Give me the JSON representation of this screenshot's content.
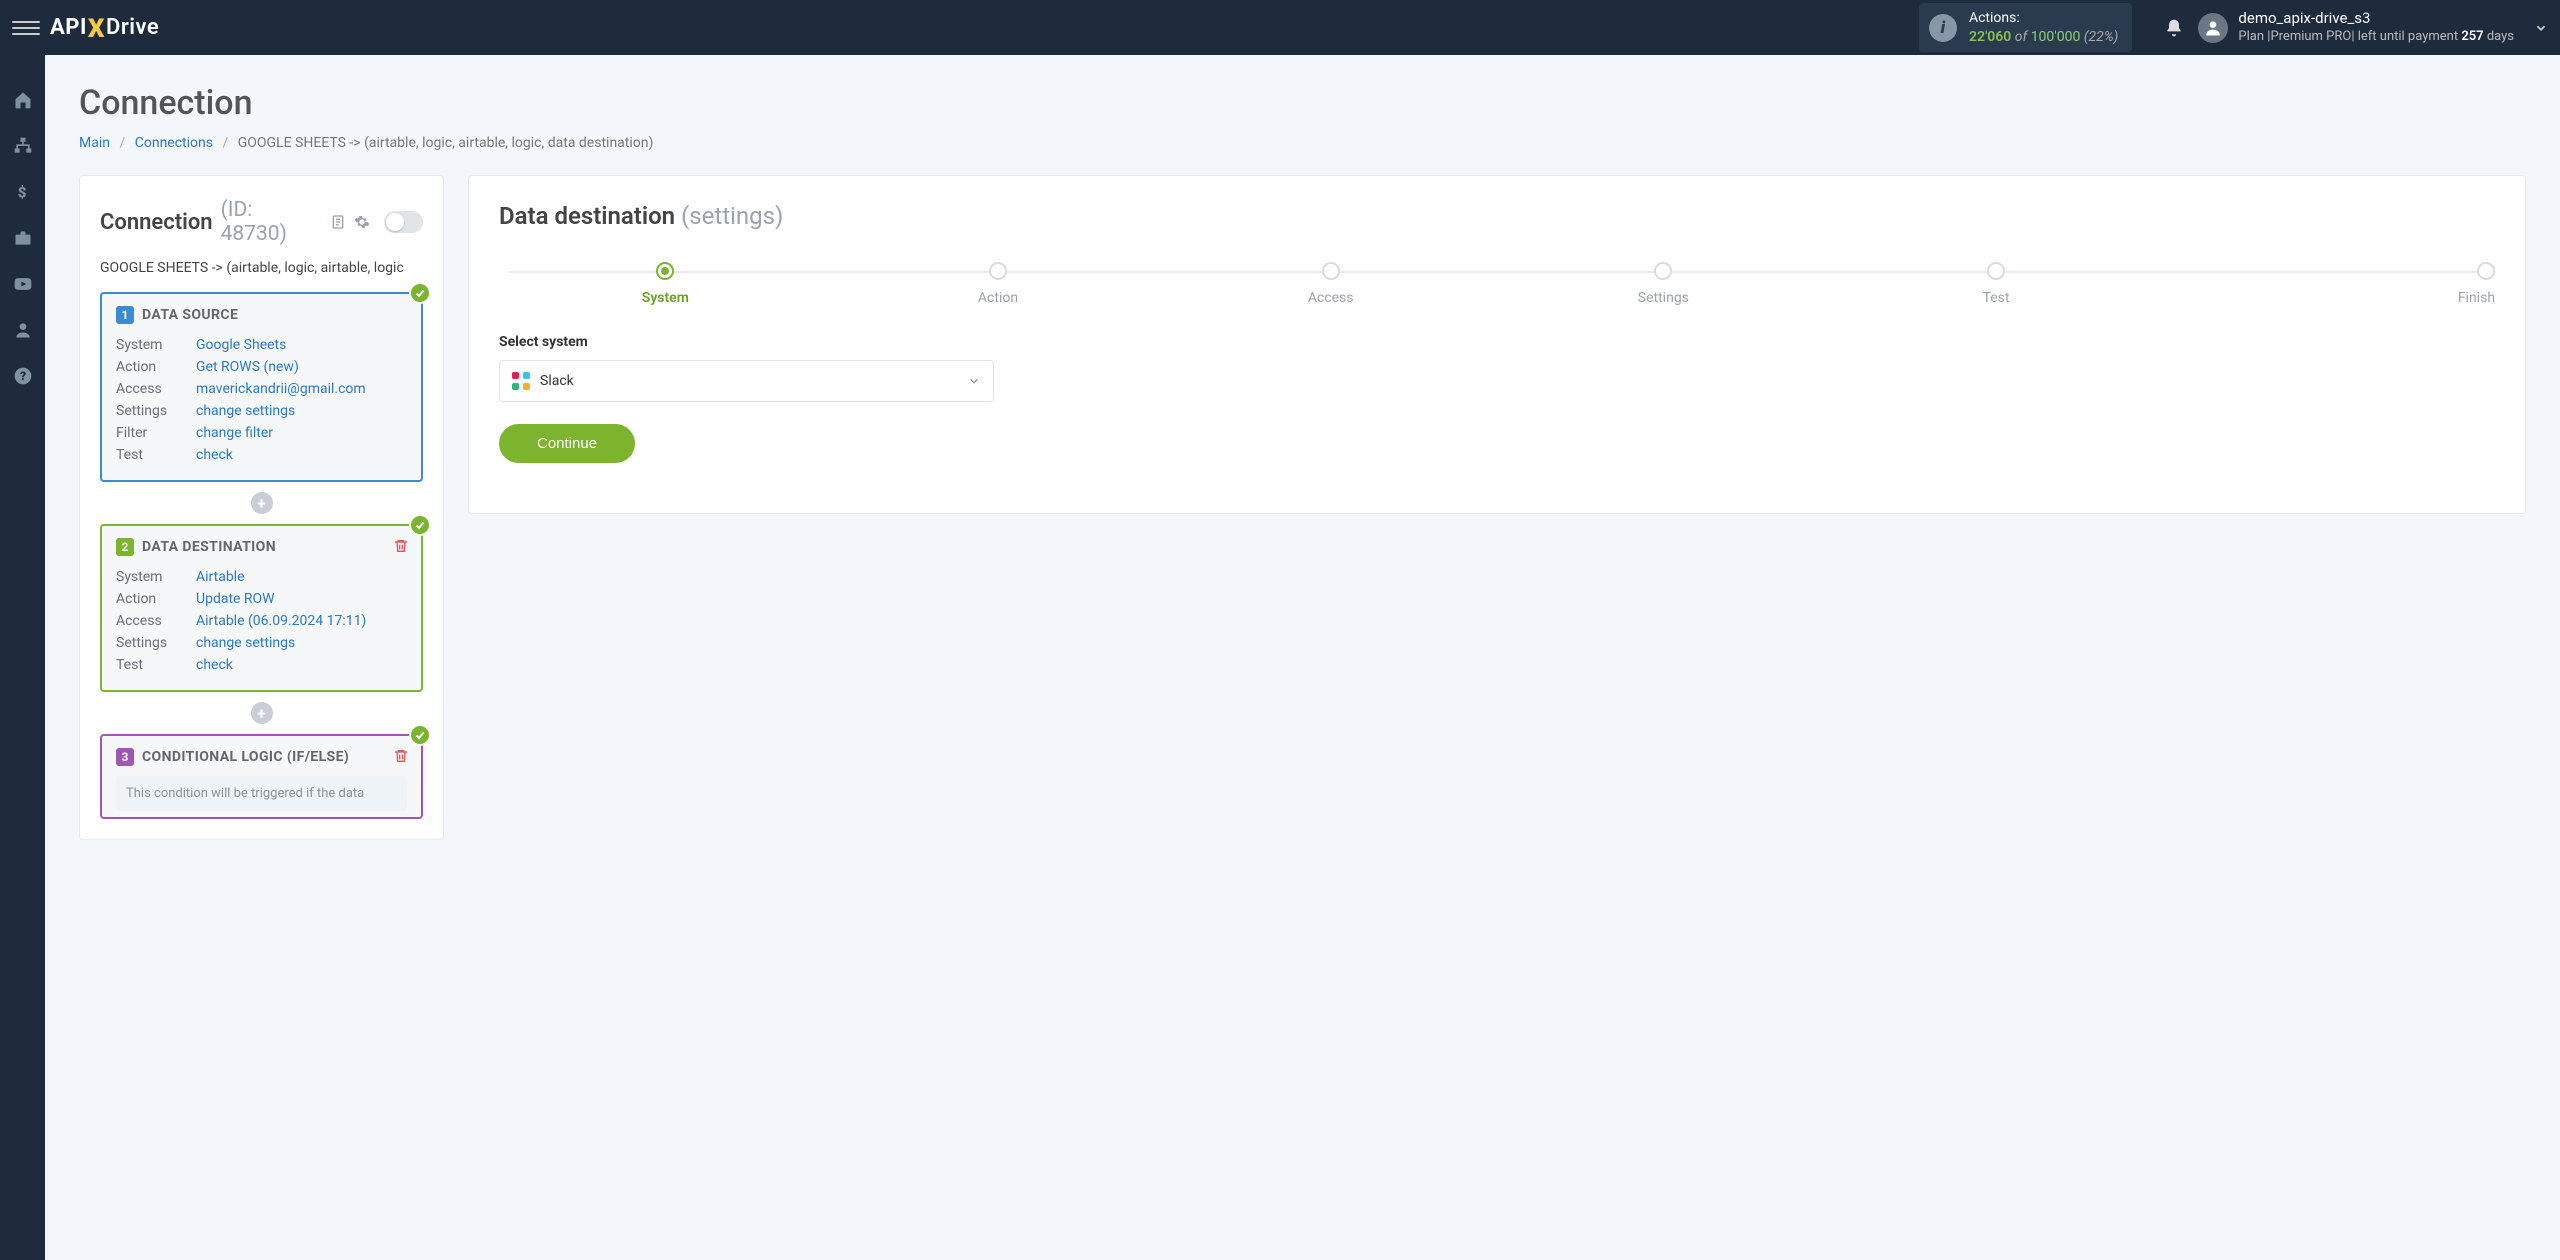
{
  "topbar": {
    "logo": {
      "part1": "API",
      "part2": "X",
      "part3": "Drive"
    },
    "actions": {
      "label": "Actions:",
      "used": "22'060",
      "of": "of",
      "limit": "100'000",
      "pct": "(22%)"
    },
    "user": {
      "name": "demo_apix-drive_s3",
      "plan_prefix": "Plan |",
      "plan_name": "Premium PRO",
      "plan_suffix": "| left until payment",
      "days": "257",
      "days_word": "days"
    }
  },
  "page": {
    "title": "Connection",
    "breadcrumb": {
      "main": "Main",
      "connections": "Connections",
      "current": "GOOGLE SHEETS -> (airtable, logic, airtable, logic, data destination)"
    }
  },
  "left": {
    "heading": "Connection",
    "id_label": "(ID: 48730)",
    "subtitle": "GOOGLE SHEETS -> (airtable, logic, airtable, logic",
    "block1": {
      "num": "1",
      "title": "DATA SOURCE",
      "rows": {
        "system_k": "System",
        "system_v": "Google Sheets",
        "action_k": "Action",
        "action_v": "Get ROWS (new)",
        "access_k": "Access",
        "access_v": "maverickandrii@gmail.com",
        "settings_k": "Settings",
        "settings_v": "change settings",
        "filter_k": "Filter",
        "filter_v": "change filter",
        "test_k": "Test",
        "test_v": "check"
      }
    },
    "block2": {
      "num": "2",
      "title": "DATA DESTINATION",
      "rows": {
        "system_k": "System",
        "system_v": "Airtable",
        "action_k": "Action",
        "action_v": "Update ROW",
        "access_k": "Access",
        "access_v": "Airtable (06.09.2024 17:11)",
        "settings_k": "Settings",
        "settings_v": "change settings",
        "test_k": "Test",
        "test_v": "check"
      }
    },
    "block3": {
      "num": "3",
      "title": "CONDITIONAL LOGIC (IF/ELSE)",
      "note": "This condition will be triggered if the data"
    }
  },
  "right": {
    "title": "Data destination",
    "title_sub": "(settings)",
    "steps": [
      "System",
      "Action",
      "Access",
      "Settings",
      "Test",
      "Finish"
    ],
    "field_label": "Select system",
    "selected": "Slack",
    "continue": "Continue"
  }
}
